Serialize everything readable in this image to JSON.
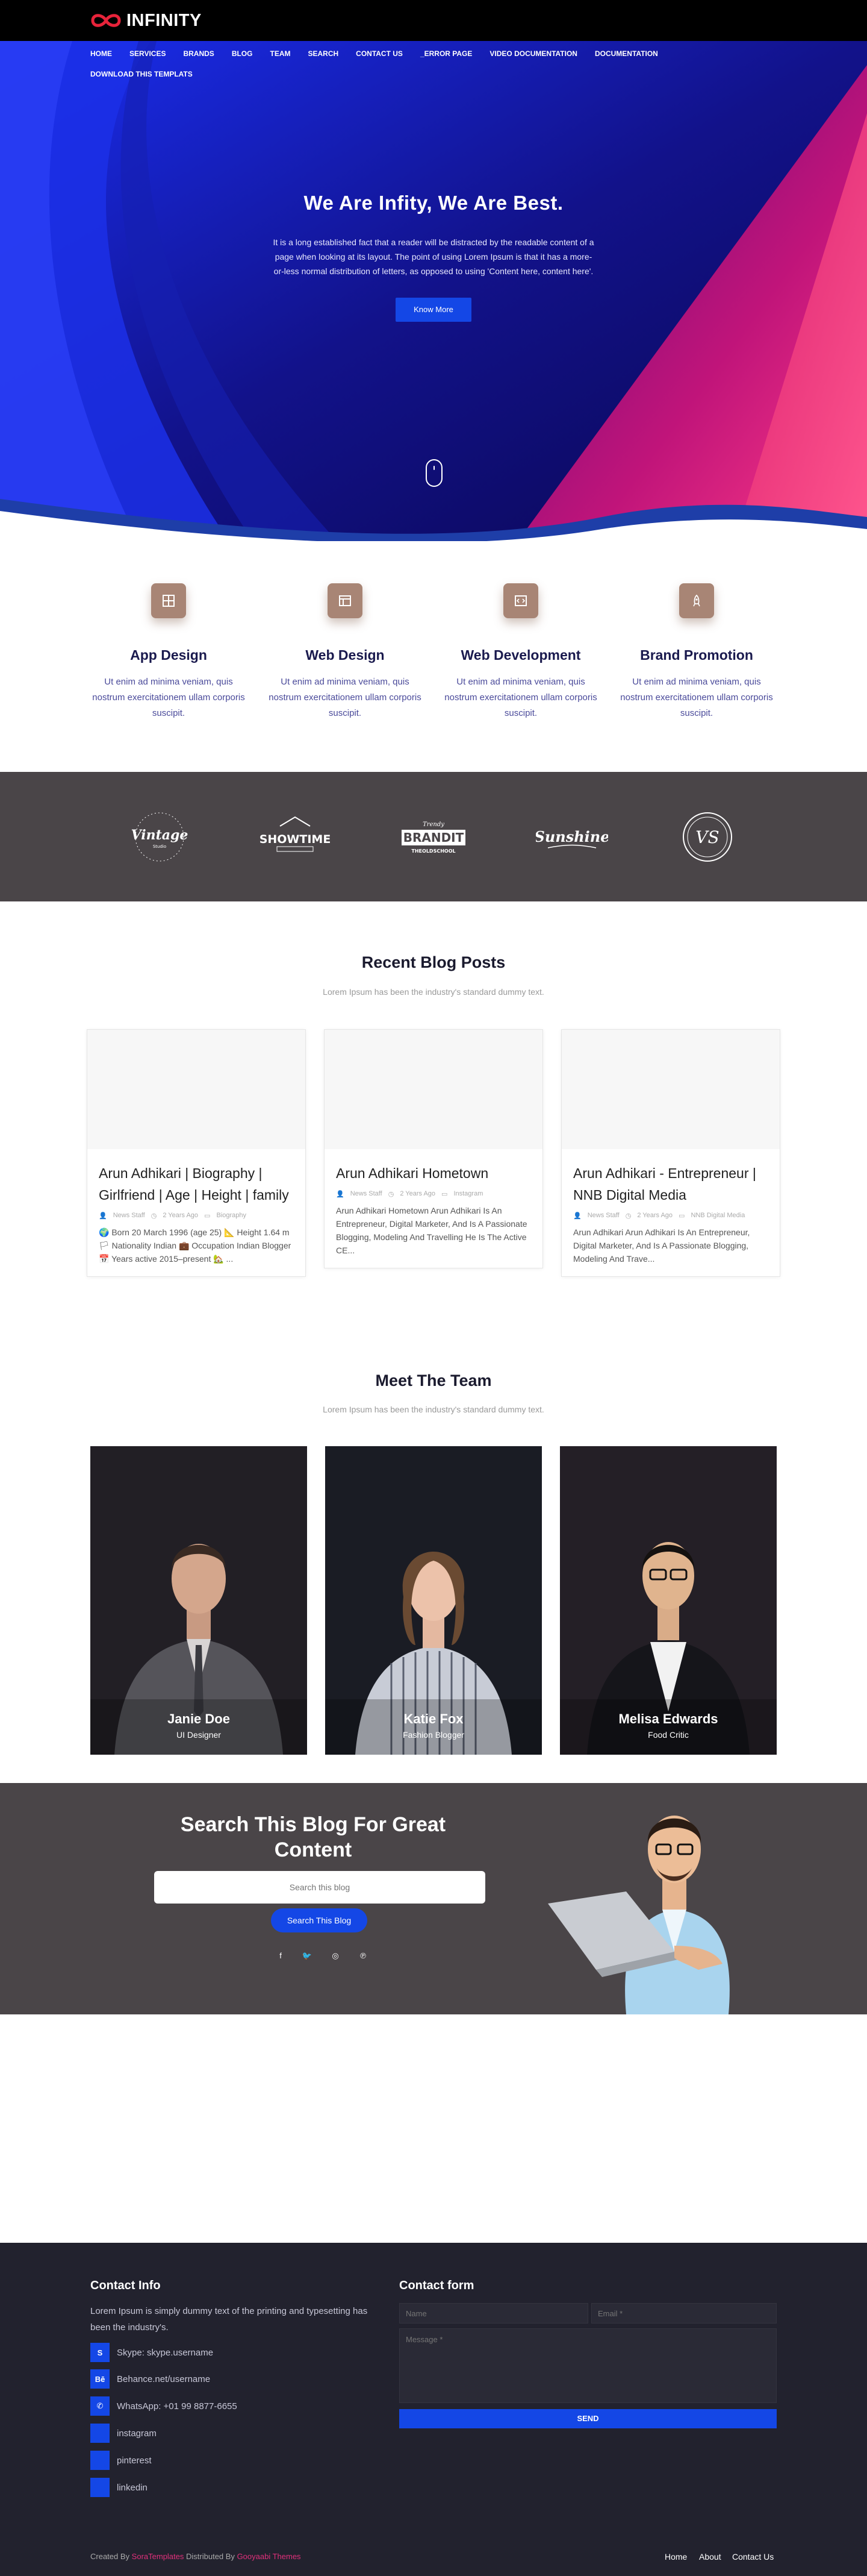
{
  "brand": {
    "name": "INFINITY"
  },
  "nav": {
    "items": [
      "Home",
      "Services",
      "Brands",
      "Blog",
      "Team",
      "Search",
      "Contact Us",
      "_Error Page",
      "Video Documentation",
      "Documentation",
      "Download This Templats"
    ]
  },
  "hero": {
    "title": "We Are Infity, We Are Best.",
    "text": "It is a long established fact that a reader will be distracted by the readable content of a page when looking at its layout. The point of using Lorem Ipsum is that it has a more-or-less normal distribution of letters, as opposed to using 'Content here, content here'.",
    "button": "Know More"
  },
  "services": [
    {
      "title": "App Design",
      "text": "Ut enim ad minima veniam, quis nostrum exercitationem ullam corporis suscipit.",
      "icon": "layout-icon"
    },
    {
      "title": "Web Design",
      "text": "Ut enim ad minima veniam, quis nostrum exercitationem ullam corporis suscipit.",
      "icon": "browser-icon"
    },
    {
      "title": "Web Development",
      "text": "Ut enim ad minima veniam, quis nostrum exercitationem ullam corporis suscipit.",
      "icon": "code-icon"
    },
    {
      "title": "Brand Promotion",
      "text": "Ut enim ad minima veniam, quis nostrum exercitationem ullam corporis suscipit.",
      "icon": "rocket-icon"
    }
  ],
  "brands": [
    "Vintage Studio",
    "Showtime",
    "Brandit",
    "Sunshine",
    "VS"
  ],
  "blog": {
    "title": "Recent Blog Posts",
    "subtitle": "Lorem Ipsum has been the industry's standard dummy text.",
    "posts": [
      {
        "title": "Arun Adhikari | Biography | Girlfriend | Age | Height | family",
        "author": "News Staff",
        "date": "2 Years Ago",
        "category": "Biography",
        "excerpt": "🌍 Born 20 March 1996 (age 25) 📐 Height 1.64 m 🏳 Nationality Indian 💼 Occupation Indian Blogger 📅 Years active 2015–present 🏡 ..."
      },
      {
        "title": "Arun Adhikari Hometown",
        "author": "News Staff",
        "date": "2 Years Ago",
        "category": "Instagram",
        "excerpt": "Arun Adhikari Hometown Arun Adhikari Is An Entrepreneur, Digital Marketer, And Is A Passionate Blogging, Modeling And Travelling He Is The Active CE..."
      },
      {
        "title": "Arun Adhikari - Entrepreneur | NNB Digital Media",
        "author": "News Staff",
        "date": "2 Years Ago",
        "category": "NNB Digital Media",
        "excerpt": "Arun Adhikari Arun Adhikari Is An Entrepreneur, Digital Marketer, And Is A Passionate Blogging, Modeling And Trave..."
      }
    ]
  },
  "team": {
    "title": "Meet The Team",
    "subtitle": "Lorem Ipsum has been the industry's standard dummy text.",
    "members": [
      {
        "name": "Janie Doe",
        "role": "UI Designer"
      },
      {
        "name": "Katie Fox",
        "role": "Fashion Blogger"
      },
      {
        "name": "Melisa Edwards",
        "role": "Food Critic"
      }
    ]
  },
  "search": {
    "title": "Search This Blog For Great Content",
    "placeholder": "Search this blog",
    "button": "Search This Blog",
    "social": [
      "facebook-icon",
      "twitter-icon",
      "instagram-icon",
      "pinterest-icon"
    ]
  },
  "footer": {
    "contact_title": "Contact Info",
    "contact_text": "Lorem Ipsum is simply dummy text of the printing and typesetting has been the industry's.",
    "items": [
      {
        "icon": "S",
        "label": "Skype: skype.username"
      },
      {
        "icon": "Bē",
        "label": "Behance.net/username"
      },
      {
        "icon": "✆",
        "label": "WhatsApp: +01 99 8877-6655"
      },
      {
        "icon": "",
        "label": "instagram"
      },
      {
        "icon": "",
        "label": "pinterest"
      },
      {
        "icon": "",
        "label": "linkedin"
      }
    ],
    "form_title": "Contact form",
    "name_placeholder": "Name",
    "email_placeholder": "Email *",
    "message_placeholder": "Message *",
    "send": "SEND",
    "created_by": "Created By",
    "author": "SoraTemplates",
    "distributed_by": "Distributed By",
    "distributor": "Gooyaabi Themes",
    "links": [
      "Home",
      "About",
      "Contact Us"
    ]
  },
  "colors": {
    "accent": "#1447e6",
    "brown": "#a88575",
    "dark": "#22222e",
    "grey": "#4a4548"
  }
}
